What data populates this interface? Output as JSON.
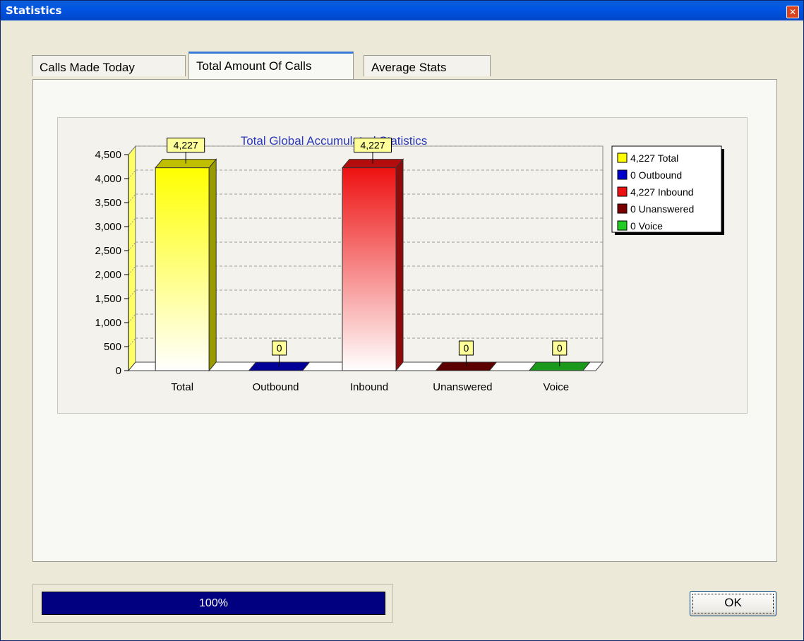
{
  "window": {
    "title": "Statistics",
    "close_icon": "close-icon"
  },
  "tabs": [
    {
      "label": "Calls Made Today",
      "active": false
    },
    {
      "label": "Total Amount Of Calls",
      "active": true
    },
    {
      "label": "Average Stats",
      "active": false
    }
  ],
  "chart_data": {
    "type": "bar",
    "title": "Total Global Accumulated Statistics",
    "categories": [
      "Total",
      "Outbound",
      "Inbound",
      "Unanswered",
      "Voice"
    ],
    "values": [
      4227,
      0,
      4227,
      0,
      0
    ],
    "value_labels": [
      "4,227",
      "0",
      "4,227",
      "0",
      "0"
    ],
    "colors": [
      "#FFFF00",
      "#0000CC",
      "#EE1111",
      "#7A0000",
      "#22CC22"
    ],
    "ylim": [
      0,
      4500
    ],
    "yticks": [
      0,
      500,
      1000,
      1500,
      2000,
      2500,
      3000,
      3500,
      4000,
      4500
    ],
    "ytick_labels": [
      "0",
      "500",
      "1,000",
      "1,500",
      "2,000",
      "2,500",
      "3,000",
      "3,500",
      "4,000",
      "4,500"
    ],
    "grid": true,
    "legend_position": "top-right",
    "legend": [
      "4,227 Total",
      "0 Outbound",
      "4,227 Inbound",
      "0 Unanswered",
      "0 Voice"
    ]
  },
  "progress": {
    "value": 1.0,
    "label": "100%"
  },
  "buttons": {
    "ok_label": "OK"
  }
}
